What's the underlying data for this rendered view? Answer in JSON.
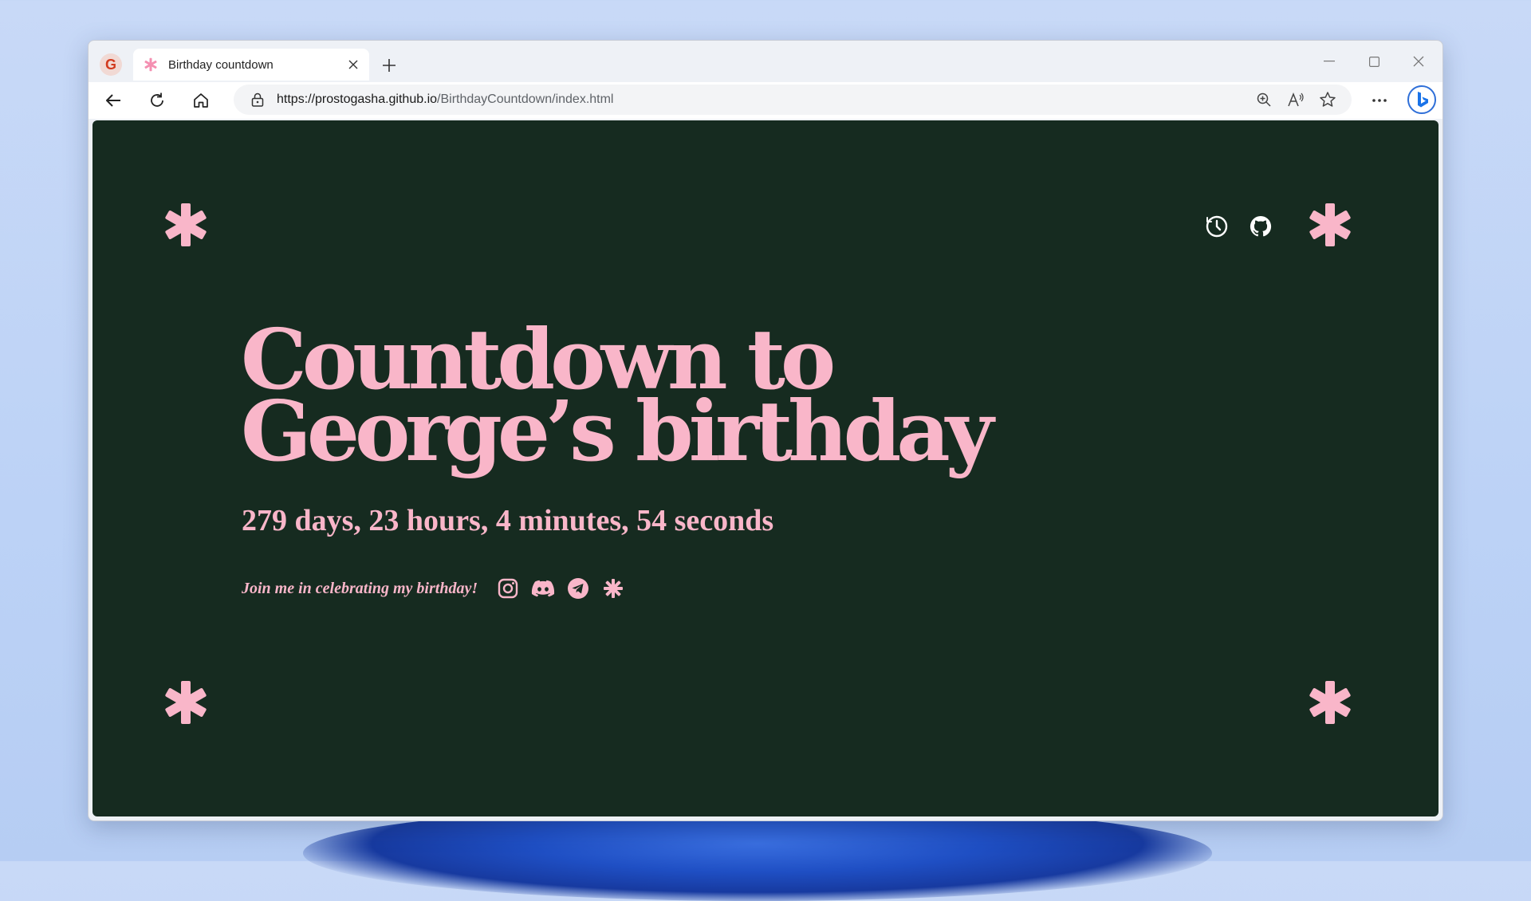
{
  "browser": {
    "tab": {
      "title": "Birthday countdown",
      "favicon": "asterisk-favicon"
    },
    "address": {
      "host": "https://prostogasha.github.io",
      "path": "/BirthdayCountdown/index.html"
    },
    "profile_initial": "G"
  },
  "page": {
    "title": "Countdown to George’s birthday",
    "countdown": "279 days, 23 hours, 4 minutes, 54 seconds",
    "cta": "Join me in celebrating my birthday!",
    "top_icons": [
      "clock-icon",
      "github-icon"
    ],
    "social_icons": [
      "instagram-icon",
      "discord-icon",
      "telegram-icon",
      "asterisk-icon"
    ]
  },
  "colors": {
    "background": "#162b20",
    "accent": "#f9b6c9"
  }
}
